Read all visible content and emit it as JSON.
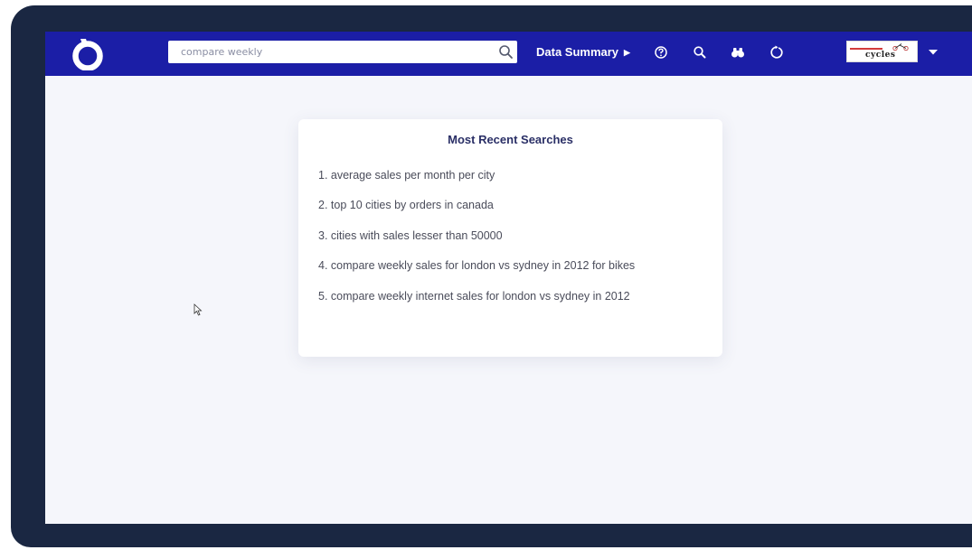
{
  "search": {
    "value": "compare weekly",
    "placeholder": ""
  },
  "nav": {
    "data_summary_label": "Data Summary",
    "icons": [
      "help-icon",
      "search-icon",
      "binoculars-icon",
      "refresh-icon"
    ]
  },
  "recent": {
    "title": "Most Recent Searches",
    "items": [
      "1. average sales per month per city",
      "2. top 10 cities by orders in canada",
      "3. cities with sales lesser than 50000",
      "4. compare weekly sales for london vs sydney in 2012 for bikes",
      "5. compare weekly internet sales for london vs sydney in 2012"
    ]
  },
  "brand": {
    "name": "cycles"
  },
  "colors": {
    "navbar": "#1b1ea6",
    "bezel": "#1a2742",
    "background": "#f5f6fb",
    "card_title": "#2a2f66"
  }
}
